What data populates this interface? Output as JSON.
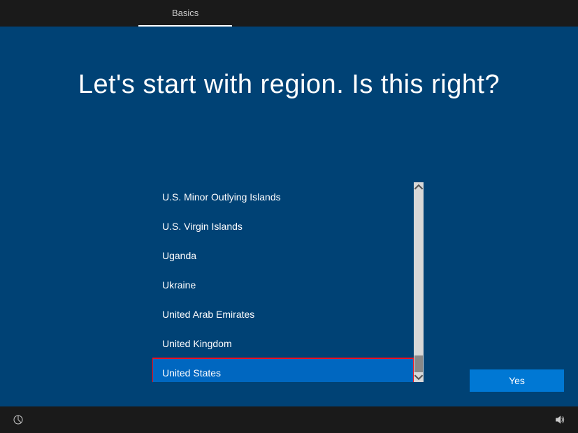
{
  "tab": {
    "label": "Basics"
  },
  "heading": "Let's start with region. Is this right?",
  "regions": {
    "items": [
      "U.S. Minor Outlying Islands",
      "U.S. Virgin Islands",
      "Uganda",
      "Ukraine",
      "United Arab Emirates",
      "United Kingdom",
      "United States"
    ],
    "selected_index": 6
  },
  "buttons": {
    "yes": "Yes"
  }
}
